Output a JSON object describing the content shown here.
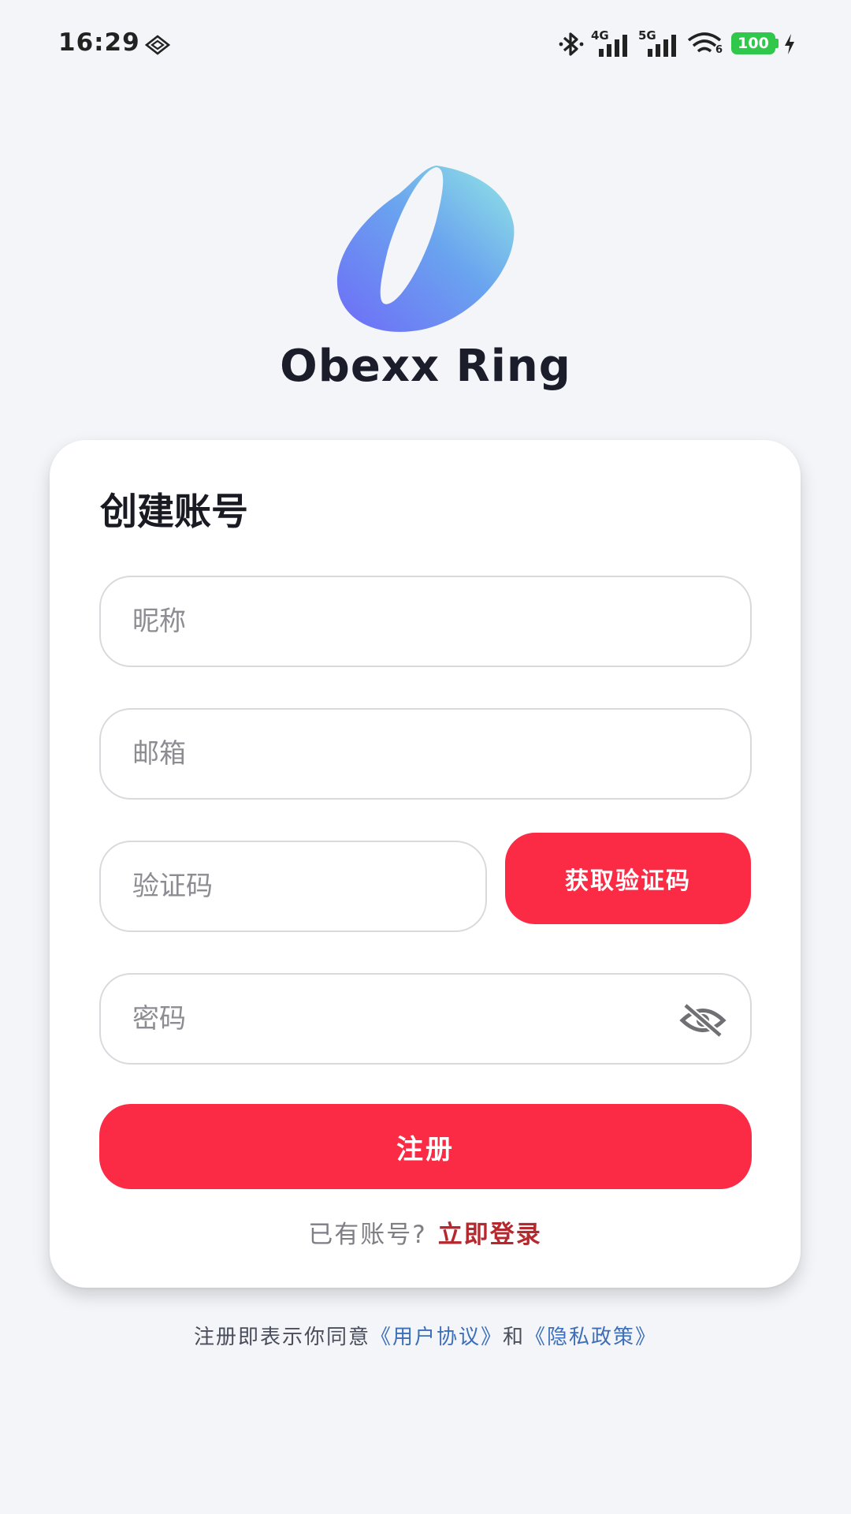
{
  "status_bar": {
    "time": "16:29",
    "network_1": "4G",
    "network_2": "5G",
    "wifi_suffix": "6",
    "battery": "100",
    "battery_color": "#2fc84a"
  },
  "app": {
    "name": "Obexx Ring",
    "logo_icon": "obexx-ring-logo"
  },
  "form": {
    "title": "创建账号",
    "nickname_placeholder": "昵称",
    "email_placeholder": "邮箱",
    "code_placeholder": "验证码",
    "get_code_label": "获取验证码",
    "password_placeholder": "密码",
    "password_toggle_icon": "eye-off-icon",
    "register_label": "注册",
    "has_account_text": "已有账号?",
    "login_link": "立即登录"
  },
  "footer": {
    "agree_prefix": "注册即表示你同意",
    "user_agreement": "《用户协议》",
    "and": "和",
    "privacy_policy": "《隐私政策》"
  },
  "colors": {
    "accent": "#fb2b45",
    "link_red": "#b4282e",
    "link_blue": "#3d6fb8",
    "background": "#f3f5f9"
  }
}
